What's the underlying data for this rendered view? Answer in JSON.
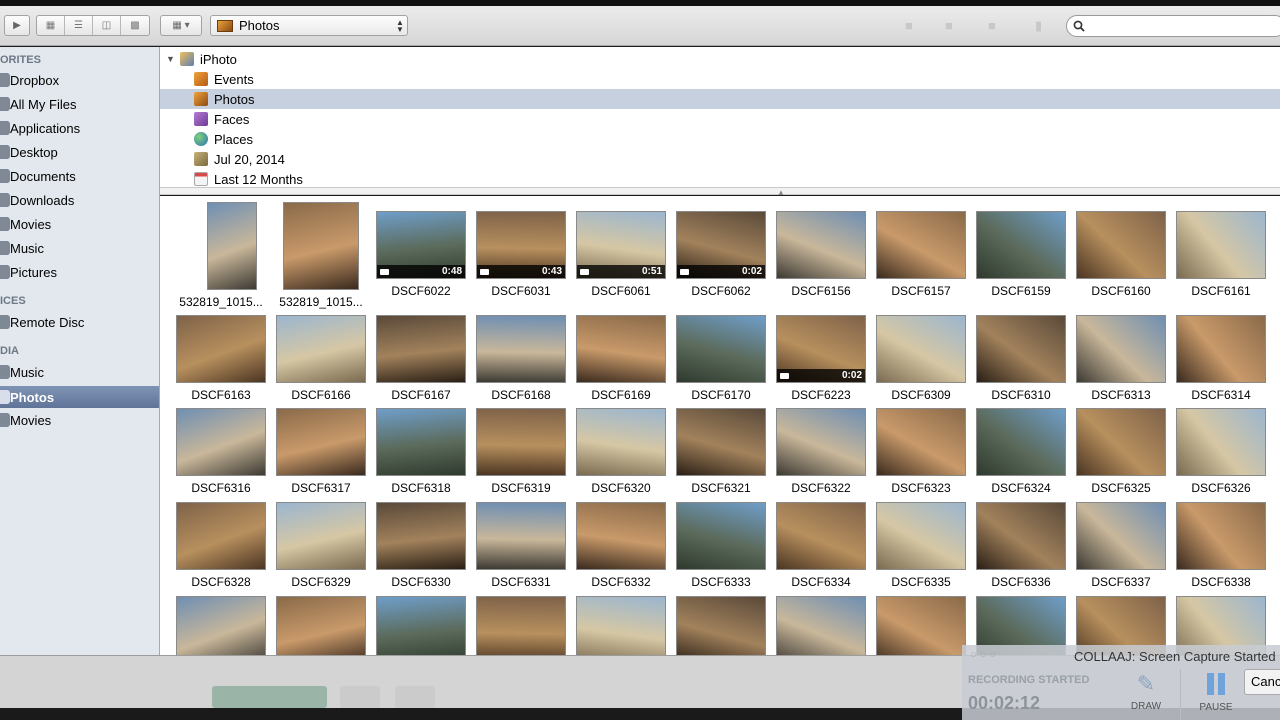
{
  "toolbar": {
    "source_popup": "Photos",
    "search_placeholder": ""
  },
  "sidebar": {
    "favorites_header": "ORITES",
    "favorites": [
      "Dropbox",
      "All My Files",
      "Applications",
      "Desktop",
      "Documents",
      "Downloads",
      "Movies",
      "Music",
      "Pictures"
    ],
    "devices_header": "ICES",
    "devices": [
      "Remote Disc"
    ],
    "media_header": "DIA",
    "media": [
      "Music",
      "Photos",
      "Movies"
    ],
    "selected": "Photos"
  },
  "tree": {
    "root": "iPhoto",
    "children": [
      "Events",
      "Photos",
      "Faces",
      "Places",
      "Jul 20, 2014",
      "Last 12 Months"
    ],
    "selected": "Photos"
  },
  "photos": [
    [
      {
        "name": "532819_1015..."
      },
      {
        "name": "532819_1015..."
      },
      {
        "name": "DSCF6022",
        "duration": "0:48"
      },
      {
        "name": "DSCF6031",
        "duration": "0:43"
      },
      {
        "name": "DSCF6061",
        "duration": "0:51"
      },
      {
        "name": "DSCF6062",
        "duration": "0:02"
      },
      {
        "name": "DSCF6156"
      },
      {
        "name": "DSCF6157"
      },
      {
        "name": "DSCF6159"
      },
      {
        "name": "DSCF6160"
      },
      {
        "name": "DSCF6161"
      }
    ],
    [
      {
        "name": "DSCF6163"
      },
      {
        "name": "DSCF6166"
      },
      {
        "name": "DSCF6167"
      },
      {
        "name": "DSCF6168"
      },
      {
        "name": "DSCF6169"
      },
      {
        "name": "DSCF6170"
      },
      {
        "name": "DSCF6223",
        "duration": "0:02"
      },
      {
        "name": "DSCF6309"
      },
      {
        "name": "DSCF6310"
      },
      {
        "name": "DSCF6313"
      },
      {
        "name": "DSCF6314"
      }
    ],
    [
      {
        "name": "DSCF6316"
      },
      {
        "name": "DSCF6317"
      },
      {
        "name": "DSCF6318"
      },
      {
        "name": "DSCF6319"
      },
      {
        "name": "DSCF6320"
      },
      {
        "name": "DSCF6321"
      },
      {
        "name": "DSCF6322"
      },
      {
        "name": "DSCF6323"
      },
      {
        "name": "DSCF6324"
      },
      {
        "name": "DSCF6325"
      },
      {
        "name": "DSCF6326"
      }
    ],
    [
      {
        "name": "DSCF6328"
      },
      {
        "name": "DSCF6329"
      },
      {
        "name": "DSCF6330"
      },
      {
        "name": "DSCF6331"
      },
      {
        "name": "DSCF6332"
      },
      {
        "name": "DSCF6333"
      },
      {
        "name": "DSCF6334"
      },
      {
        "name": "DSCF6335"
      },
      {
        "name": "DSCF6336"
      },
      {
        "name": "DSCF6337"
      },
      {
        "name": "DSCF6338"
      }
    ],
    [
      {
        "name": ""
      },
      {
        "name": ""
      },
      {
        "name": ""
      },
      {
        "name": ""
      },
      {
        "name": ""
      },
      {
        "name": ""
      },
      {
        "name": ""
      },
      {
        "name": ""
      },
      {
        "name": ""
      },
      {
        "name": ""
      },
      {
        "name": ""
      }
    ]
  ],
  "recorder": {
    "title": "COLLAAJ: Screen Capture Started",
    "status": "RECORDING STARTED",
    "timer": "00:02:12",
    "draw_label": "DRAW",
    "pause_label": "PAUSE",
    "cancel_label": "Cancel"
  },
  "colors": {
    "sidebar_bg": "#e3e8ee",
    "sidebar_selected": "#6b80a3",
    "tree_selected": "#c7d0de"
  }
}
